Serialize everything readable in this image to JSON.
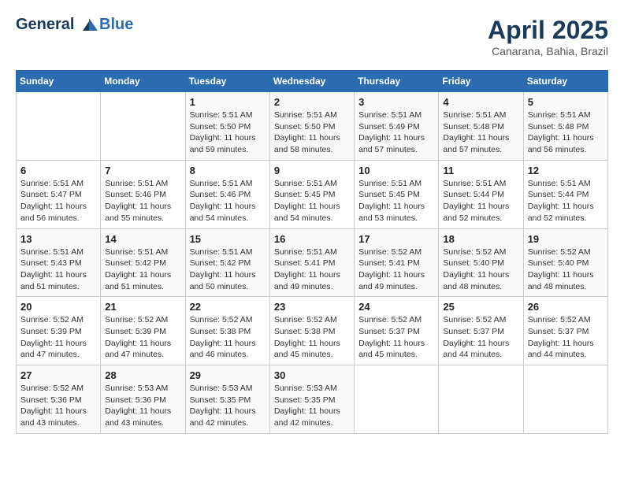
{
  "header": {
    "logo_line1": "General",
    "logo_line2": "Blue",
    "month_title": "April 2025",
    "location": "Canarana, Bahia, Brazil"
  },
  "weekdays": [
    "Sunday",
    "Monday",
    "Tuesday",
    "Wednesday",
    "Thursday",
    "Friday",
    "Saturday"
  ],
  "weeks": [
    [
      {
        "day": "",
        "sunrise": "",
        "sunset": "",
        "daylight": ""
      },
      {
        "day": "",
        "sunrise": "",
        "sunset": "",
        "daylight": ""
      },
      {
        "day": "1",
        "sunrise": "Sunrise: 5:51 AM",
        "sunset": "Sunset: 5:50 PM",
        "daylight": "Daylight: 11 hours and 59 minutes."
      },
      {
        "day": "2",
        "sunrise": "Sunrise: 5:51 AM",
        "sunset": "Sunset: 5:50 PM",
        "daylight": "Daylight: 11 hours and 58 minutes."
      },
      {
        "day": "3",
        "sunrise": "Sunrise: 5:51 AM",
        "sunset": "Sunset: 5:49 PM",
        "daylight": "Daylight: 11 hours and 57 minutes."
      },
      {
        "day": "4",
        "sunrise": "Sunrise: 5:51 AM",
        "sunset": "Sunset: 5:48 PM",
        "daylight": "Daylight: 11 hours and 57 minutes."
      },
      {
        "day": "5",
        "sunrise": "Sunrise: 5:51 AM",
        "sunset": "Sunset: 5:48 PM",
        "daylight": "Daylight: 11 hours and 56 minutes."
      }
    ],
    [
      {
        "day": "6",
        "sunrise": "Sunrise: 5:51 AM",
        "sunset": "Sunset: 5:47 PM",
        "daylight": "Daylight: 11 hours and 56 minutes."
      },
      {
        "day": "7",
        "sunrise": "Sunrise: 5:51 AM",
        "sunset": "Sunset: 5:46 PM",
        "daylight": "Daylight: 11 hours and 55 minutes."
      },
      {
        "day": "8",
        "sunrise": "Sunrise: 5:51 AM",
        "sunset": "Sunset: 5:46 PM",
        "daylight": "Daylight: 11 hours and 54 minutes."
      },
      {
        "day": "9",
        "sunrise": "Sunrise: 5:51 AM",
        "sunset": "Sunset: 5:45 PM",
        "daylight": "Daylight: 11 hours and 54 minutes."
      },
      {
        "day": "10",
        "sunrise": "Sunrise: 5:51 AM",
        "sunset": "Sunset: 5:45 PM",
        "daylight": "Daylight: 11 hours and 53 minutes."
      },
      {
        "day": "11",
        "sunrise": "Sunrise: 5:51 AM",
        "sunset": "Sunset: 5:44 PM",
        "daylight": "Daylight: 11 hours and 52 minutes."
      },
      {
        "day": "12",
        "sunrise": "Sunrise: 5:51 AM",
        "sunset": "Sunset: 5:44 PM",
        "daylight": "Daylight: 11 hours and 52 minutes."
      }
    ],
    [
      {
        "day": "13",
        "sunrise": "Sunrise: 5:51 AM",
        "sunset": "Sunset: 5:43 PM",
        "daylight": "Daylight: 11 hours and 51 minutes."
      },
      {
        "day": "14",
        "sunrise": "Sunrise: 5:51 AM",
        "sunset": "Sunset: 5:42 PM",
        "daylight": "Daylight: 11 hours and 51 minutes."
      },
      {
        "day": "15",
        "sunrise": "Sunrise: 5:51 AM",
        "sunset": "Sunset: 5:42 PM",
        "daylight": "Daylight: 11 hours and 50 minutes."
      },
      {
        "day": "16",
        "sunrise": "Sunrise: 5:51 AM",
        "sunset": "Sunset: 5:41 PM",
        "daylight": "Daylight: 11 hours and 49 minutes."
      },
      {
        "day": "17",
        "sunrise": "Sunrise: 5:52 AM",
        "sunset": "Sunset: 5:41 PM",
        "daylight": "Daylight: 11 hours and 49 minutes."
      },
      {
        "day": "18",
        "sunrise": "Sunrise: 5:52 AM",
        "sunset": "Sunset: 5:40 PM",
        "daylight": "Daylight: 11 hours and 48 minutes."
      },
      {
        "day": "19",
        "sunrise": "Sunrise: 5:52 AM",
        "sunset": "Sunset: 5:40 PM",
        "daylight": "Daylight: 11 hours and 48 minutes."
      }
    ],
    [
      {
        "day": "20",
        "sunrise": "Sunrise: 5:52 AM",
        "sunset": "Sunset: 5:39 PM",
        "daylight": "Daylight: 11 hours and 47 minutes."
      },
      {
        "day": "21",
        "sunrise": "Sunrise: 5:52 AM",
        "sunset": "Sunset: 5:39 PM",
        "daylight": "Daylight: 11 hours and 47 minutes."
      },
      {
        "day": "22",
        "sunrise": "Sunrise: 5:52 AM",
        "sunset": "Sunset: 5:38 PM",
        "daylight": "Daylight: 11 hours and 46 minutes."
      },
      {
        "day": "23",
        "sunrise": "Sunrise: 5:52 AM",
        "sunset": "Sunset: 5:38 PM",
        "daylight": "Daylight: 11 hours and 45 minutes."
      },
      {
        "day": "24",
        "sunrise": "Sunrise: 5:52 AM",
        "sunset": "Sunset: 5:37 PM",
        "daylight": "Daylight: 11 hours and 45 minutes."
      },
      {
        "day": "25",
        "sunrise": "Sunrise: 5:52 AM",
        "sunset": "Sunset: 5:37 PM",
        "daylight": "Daylight: 11 hours and 44 minutes."
      },
      {
        "day": "26",
        "sunrise": "Sunrise: 5:52 AM",
        "sunset": "Sunset: 5:37 PM",
        "daylight": "Daylight: 11 hours and 44 minutes."
      }
    ],
    [
      {
        "day": "27",
        "sunrise": "Sunrise: 5:52 AM",
        "sunset": "Sunset: 5:36 PM",
        "daylight": "Daylight: 11 hours and 43 minutes."
      },
      {
        "day": "28",
        "sunrise": "Sunrise: 5:53 AM",
        "sunset": "Sunset: 5:36 PM",
        "daylight": "Daylight: 11 hours and 43 minutes."
      },
      {
        "day": "29",
        "sunrise": "Sunrise: 5:53 AM",
        "sunset": "Sunset: 5:35 PM",
        "daylight": "Daylight: 11 hours and 42 minutes."
      },
      {
        "day": "30",
        "sunrise": "Sunrise: 5:53 AM",
        "sunset": "Sunset: 5:35 PM",
        "daylight": "Daylight: 11 hours and 42 minutes."
      },
      {
        "day": "",
        "sunrise": "",
        "sunset": "",
        "daylight": ""
      },
      {
        "day": "",
        "sunrise": "",
        "sunset": "",
        "daylight": ""
      },
      {
        "day": "",
        "sunrise": "",
        "sunset": "",
        "daylight": ""
      }
    ]
  ]
}
